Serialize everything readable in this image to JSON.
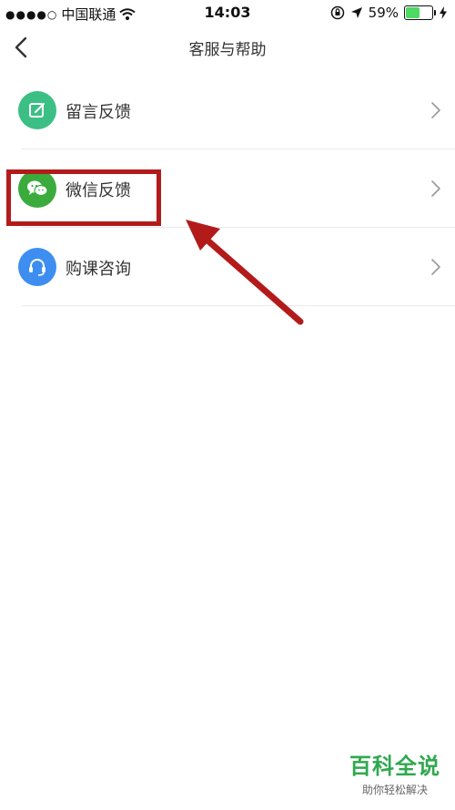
{
  "status_bar": {
    "signal_dots": "●●●●○",
    "carrier": "中国联通",
    "time": "14:03",
    "battery_percent": "59%",
    "battery_level": 0.59
  },
  "nav": {
    "title": "客服与帮助"
  },
  "menu": {
    "items": [
      {
        "label": "留言反馈",
        "icon": "edit-icon",
        "color": "#3cbf84"
      },
      {
        "label": "微信反馈",
        "icon": "wechat-icon",
        "color": "#3aab3c"
      },
      {
        "label": "购课咨询",
        "icon": "headset-icon",
        "color": "#3d8ef0"
      }
    ]
  },
  "annotation": {
    "color": "#b31b1b"
  },
  "watermark": {
    "title": "百科全说",
    "subtitle": "助你轻松解决"
  }
}
